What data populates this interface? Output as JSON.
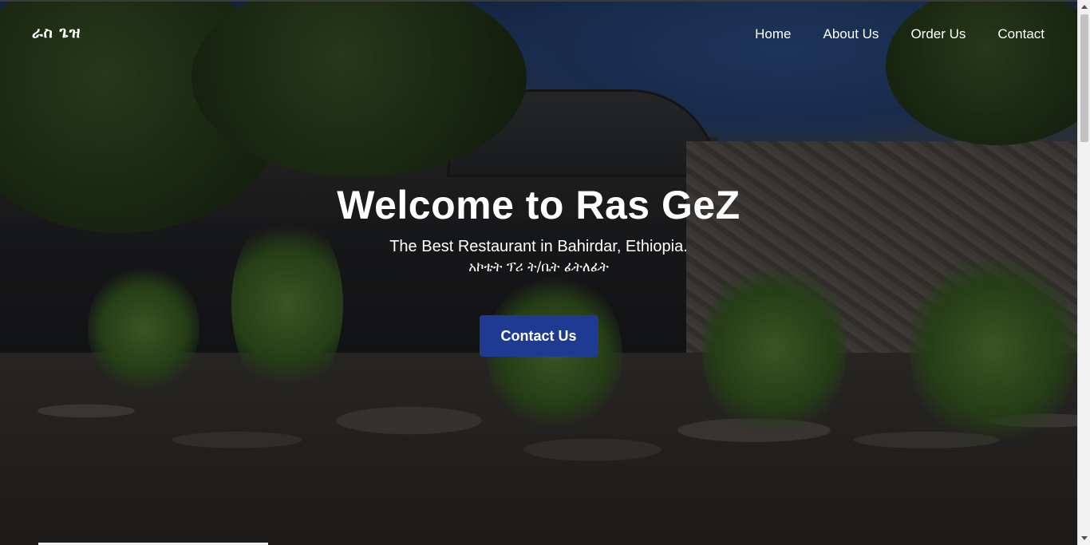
{
  "brand": {
    "name": "ራስ ጌዝ"
  },
  "nav": {
    "items": [
      {
        "label": "Home"
      },
      {
        "label": "About Us"
      },
      {
        "label": "Order Us"
      },
      {
        "label": "Contact"
      }
    ]
  },
  "hero": {
    "title": "Welcome to Ras GeZ",
    "subtitle": "The Best Restaurant in Bahirdar, Ethiopia.",
    "subtitle_amharic": "አኮቴት ፕሪ ት/ቤት ፊትለፊት",
    "cta_label": "Contact Us"
  },
  "colors": {
    "cta_background": "#1f3a93",
    "text": "#ffffff"
  }
}
